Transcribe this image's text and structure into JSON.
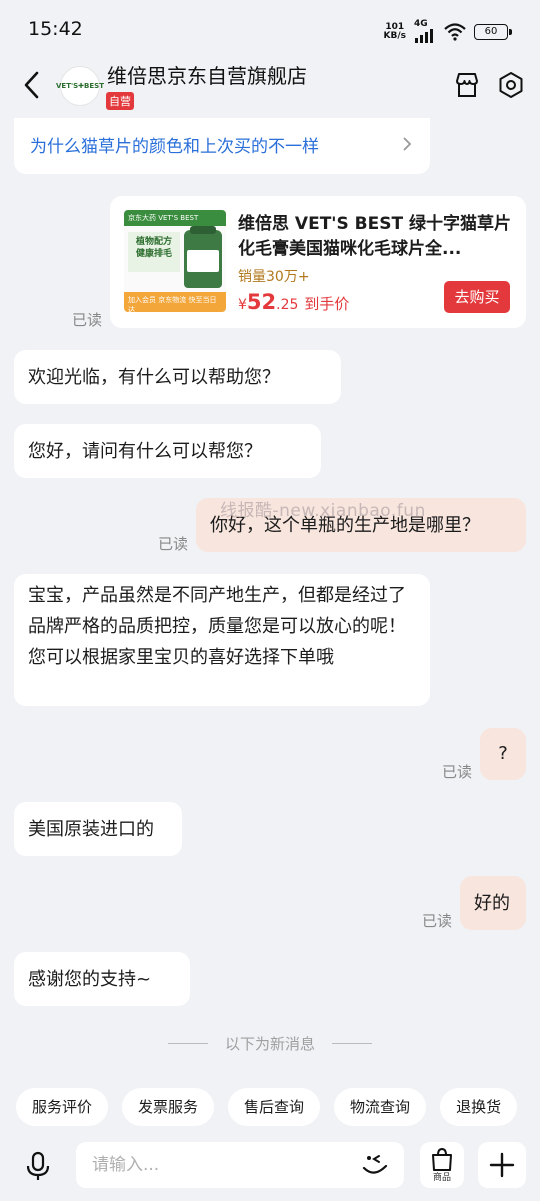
{
  "status_bar": {
    "time": "15:42",
    "net_speed_value": "101",
    "net_speed_unit": "KB/s",
    "network_type": "4G",
    "battery": "60"
  },
  "header": {
    "shop_name": "维倍思京东自营旗舰店",
    "self_badge": "自营",
    "logo_text": "VET'S✚BEST"
  },
  "faq": {
    "question": "为什么猫草片的颜色和上次买的不一样"
  },
  "product": {
    "title": "维倍思 VET'S BEST 绿十字猫草片化毛膏美国猫咪化毛球片全...",
    "sales": "销量30万+",
    "price_symbol": "¥",
    "price_int": "52",
    "price_dec": ".25",
    "price_note": "到手价",
    "buy_label": "去购买",
    "thumb_top": "京东大药 VET'S BEST",
    "thumb_block": "植物配方\n健康排毛",
    "thumb_bottom": "加入会员 京东物流 快至当日达",
    "read_mark": "已读"
  },
  "messages": [
    {
      "side": "left",
      "text": "欢迎光临，有什么可以帮助您？"
    },
    {
      "side": "left",
      "text": "您好，请问有什么可以帮您？"
    },
    {
      "side": "right",
      "text": "你好，这个单瓶的生产地是哪里？",
      "read": "已读"
    },
    {
      "side": "left",
      "text": "  宝宝，产品虽然是不同产地生产，但都是经过了品牌严格的品质把控，质量您是可以放心的呢！您可以根据家里宝贝的喜好选择下单哦"
    },
    {
      "side": "right",
      "text": "?",
      "read": "已读"
    },
    {
      "side": "left",
      "text": "美国原装进口的"
    },
    {
      "side": "right",
      "text": "好的",
      "read": "已读"
    },
    {
      "side": "left",
      "text": "感谢您的支持~"
    }
  ],
  "watermark": "线报酷-new.xianbao.fun",
  "divider_text": "以下为新消息",
  "quick_actions": [
    "服务评价",
    "发票服务",
    "售后查询",
    "物流查询",
    "退换货"
  ],
  "input": {
    "placeholder": "请输入...",
    "goods_label": "商品"
  },
  "colors": {
    "accent_red": "#e4393c",
    "link_blue": "#2a6fd9",
    "own_bubble": "#f7e5de",
    "background": "#f1f2f6"
  }
}
